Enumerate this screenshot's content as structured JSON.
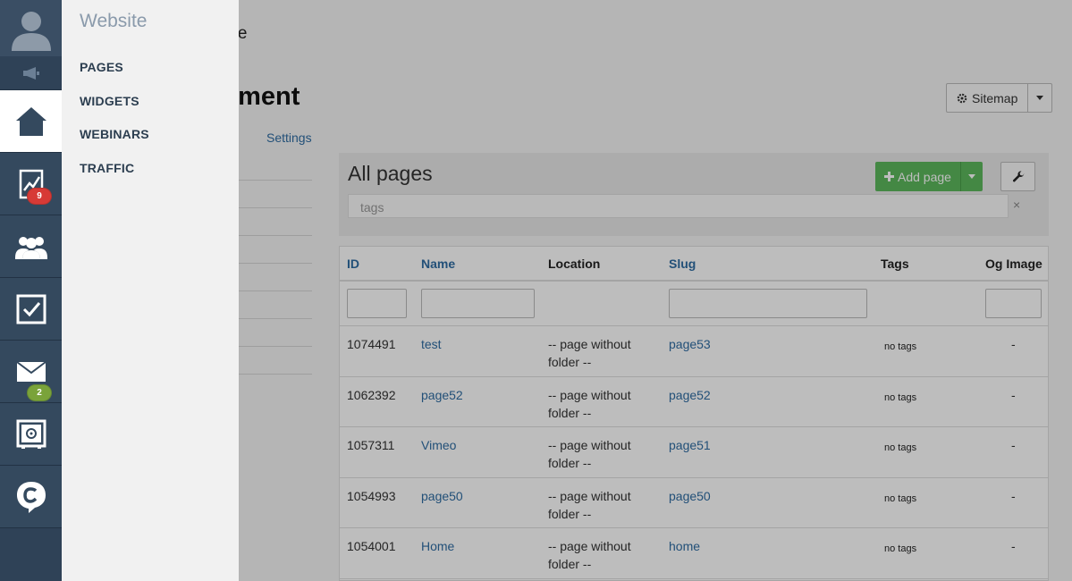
{
  "rail": {
    "badges": {
      "stats": "9",
      "mail": "2"
    }
  },
  "flyout": {
    "title": "Website",
    "items": [
      {
        "label": "PAGES"
      },
      {
        "label": "WIDGETS"
      },
      {
        "label": "WEBINARS"
      },
      {
        "label": "TRAFFIC"
      }
    ]
  },
  "page": {
    "breadcrumb": "me",
    "heading": "ement",
    "tab_settings": "Settings",
    "sitemap_label": "Sitemap",
    "panel_title": "All pages",
    "add_page_label": "Add page",
    "tags_placeholder": "tags",
    "tags_clear": "×"
  },
  "table": {
    "columns": [
      "ID",
      "Name",
      "Location",
      "Slug",
      "Tags",
      "Og Image"
    ],
    "rows": [
      {
        "id": "1074491",
        "name": "test",
        "location": "-- page without folder --",
        "slug": "page53",
        "tags": "no tags",
        "og": "-"
      },
      {
        "id": "1062392",
        "name": "page52",
        "location": "-- page without folder --",
        "slug": "page52",
        "tags": "no tags",
        "og": "-"
      },
      {
        "id": "1057311",
        "name": "Vimeo",
        "location": "-- page without folder --",
        "slug": "page51",
        "tags": "no tags",
        "og": "-"
      },
      {
        "id": "1054993",
        "name": "page50",
        "location": "-- page without folder --",
        "slug": "page50",
        "tags": "no tags",
        "og": "-"
      },
      {
        "id": "1054001",
        "name": "Home",
        "location": "-- page without folder --",
        "slug": "home",
        "tags": "no tags",
        "og": "-"
      }
    ]
  },
  "colors": {
    "rail_bg": "#34495e",
    "accent_green": "#5cb85c",
    "link_blue": "#2f6ca3",
    "badge_red": "#d73a36",
    "badge_green": "#7aa33a"
  }
}
